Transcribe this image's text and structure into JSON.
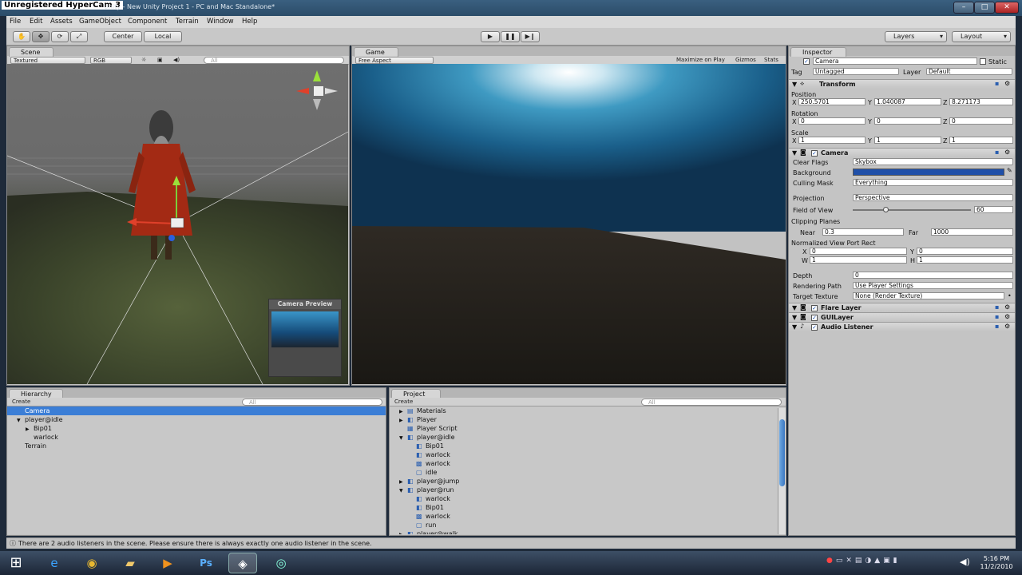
{
  "watermark": "Unregistered HyperCam 3",
  "window": {
    "title": "Unity - New Unity Project 1 - PC and Mac Standalone*",
    "min": "–",
    "max": "□",
    "close": "✕"
  },
  "menu": [
    "File",
    "Edit",
    "Assets",
    "GameObject",
    "Component",
    "Terrain",
    "Window",
    "Help"
  ],
  "toolbar": {
    "center": "Center",
    "local": "Local",
    "layers": "Layers",
    "layout": "Layout"
  },
  "scene": {
    "tab": "Scene",
    "render_mode": "Textured",
    "color_mode": "RGB",
    "search_placeholder": "All",
    "camera_preview": "Camera Preview"
  },
  "game": {
    "tab": "Game",
    "aspect": "Free Aspect",
    "maximize": "Maximize on Play",
    "gizmos": "Gizmos",
    "stats": "Stats"
  },
  "inspector": {
    "tab": "Inspector",
    "object_name": "Camera",
    "static": "Static",
    "tag_label": "Tag",
    "tag_value": "Untagged",
    "layer_label": "Layer",
    "layer_value": "Default",
    "transform": {
      "title": "Transform",
      "position": "Position",
      "pos": [
        "250.5701",
        "1.040087",
        "8.271173"
      ],
      "rotation": "Rotation",
      "rot": [
        "0",
        "0",
        "0"
      ],
      "scale": "Scale",
      "scl": [
        "1",
        "1",
        "1"
      ]
    },
    "camera": {
      "title": "Camera",
      "clear_flags": "Clear Flags",
      "clear_flags_value": "Skybox",
      "background": "Background",
      "background_color": "#1f4fa8",
      "culling_mask": "Culling Mask",
      "culling_mask_value": "Everything",
      "projection": "Projection",
      "projection_value": "Perspective",
      "fov": "Field of View",
      "fov_value": "60",
      "fov_fraction": 0.28,
      "clipping": "Clipping Planes",
      "near": "Near",
      "near_value": "0.3",
      "far": "Far",
      "far_value": "1000",
      "viewport": "Normalized View Port Rect",
      "vp": {
        "x": "0",
        "y": "0",
        "w": "1",
        "h": "1"
      },
      "depth": "Depth",
      "depth_value": "0",
      "rendering_path": "Rendering Path",
      "rendering_path_value": "Use Player Settings",
      "target_texture": "Target Texture",
      "target_texture_value": "None (Render Texture)"
    },
    "flare": "Flare Layer",
    "gui": "GUILayer",
    "audio": "Audio Listener"
  },
  "hierarchy": {
    "tab": "Hierarchy",
    "create": "Create",
    "items": [
      {
        "label": "Camera",
        "indent": 0,
        "selected": true,
        "arrow": ""
      },
      {
        "label": "player@idle",
        "indent": 0,
        "selected": false,
        "arrow": "▼"
      },
      {
        "label": "Bip01",
        "indent": 1,
        "selected": false,
        "arrow": "▶"
      },
      {
        "label": "warlock",
        "indent": 1,
        "selected": false,
        "arrow": ""
      },
      {
        "label": "Terrain",
        "indent": 0,
        "selected": false,
        "arrow": ""
      }
    ]
  },
  "project": {
    "tab": "Project",
    "create": "Create",
    "items": [
      {
        "label": "Materials",
        "indent": 0,
        "arrow": "▶",
        "icon": "folder-icon"
      },
      {
        "label": "Player",
        "indent": 0,
        "arrow": "▶",
        "icon": "prefab-icon"
      },
      {
        "label": "Player Script",
        "indent": 0,
        "arrow": "",
        "icon": "script-icon"
      },
      {
        "label": "player@idle",
        "indent": 0,
        "arrow": "▼",
        "icon": "prefab-icon"
      },
      {
        "label": "Bip01",
        "indent": 1,
        "arrow": "",
        "icon": "prefab-icon"
      },
      {
        "label": "warlock",
        "indent": 1,
        "arrow": "",
        "icon": "prefab-icon"
      },
      {
        "label": "warlock",
        "indent": 1,
        "arrow": "",
        "icon": "mesh-icon"
      },
      {
        "label": "idle",
        "indent": 1,
        "arrow": "",
        "icon": "anim-icon"
      },
      {
        "label": "player@jump",
        "indent": 0,
        "arrow": "▶",
        "icon": "prefab-icon"
      },
      {
        "label": "player@run",
        "indent": 0,
        "arrow": "▼",
        "icon": "prefab-icon"
      },
      {
        "label": "warlock",
        "indent": 1,
        "arrow": "",
        "icon": "prefab-icon"
      },
      {
        "label": "Bip01",
        "indent": 1,
        "arrow": "",
        "icon": "prefab-icon"
      },
      {
        "label": "warlock",
        "indent": 1,
        "arrow": "",
        "icon": "mesh-icon"
      },
      {
        "label": "run",
        "indent": 1,
        "arrow": "",
        "icon": "anim-icon"
      },
      {
        "label": "player@walk",
        "indent": 0,
        "arrow": "▶",
        "icon": "prefab-icon"
      }
    ]
  },
  "status": "There are 2 audio listeners in the scene. Please ensure there is always exactly one audio listener in the scene.",
  "clock": {
    "time": "5:16 PM",
    "date": "11/2/2010"
  }
}
